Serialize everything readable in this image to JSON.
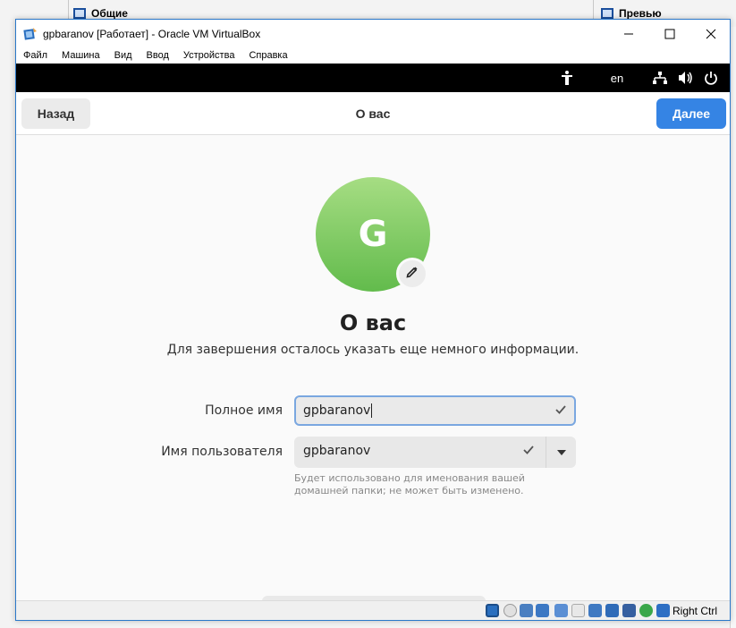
{
  "background": {
    "general_label": "Общие",
    "preview_label": "Превью"
  },
  "window": {
    "title": "gpbaranov [Работает] - Oracle VM VirtualBox",
    "controls": {
      "minimize": "—",
      "maximize": "☐",
      "close": "✕"
    }
  },
  "menubar": {
    "items": [
      "Файл",
      "Машина",
      "Вид",
      "Ввод",
      "Устройства",
      "Справка"
    ]
  },
  "topbar": {
    "language": "en",
    "icons": [
      "accessibility-icon",
      "network-icon",
      "volume-icon",
      "power-icon"
    ]
  },
  "headerbar": {
    "back_label": "Назад",
    "title": "О вас",
    "next_label": "Далее",
    "accent_color": "#3584e4"
  },
  "content": {
    "avatar_letter": "G",
    "avatar_color": "#7ac85c",
    "heading": "О вас",
    "subtitle": "Для завершения осталось указать еще немного информации.",
    "fullname_label": "Полное имя",
    "fullname_value": "gpbaranov",
    "username_label": "Имя пользователя",
    "username_value": "gpbaranov",
    "username_hint": "Будет использовано для именования вашей домашней папки; не может быть изменено."
  },
  "statusbar": {
    "host_key": "Right Ctrl",
    "icons": [
      "hdd-icon",
      "optical-icon",
      "audio-icon",
      "network-icon",
      "usb-icon",
      "shared-folders-icon",
      "display-icon",
      "video-capture-icon",
      "vm-state-icon",
      "vm-green-icon",
      "keyboard-capture-icon"
    ]
  }
}
